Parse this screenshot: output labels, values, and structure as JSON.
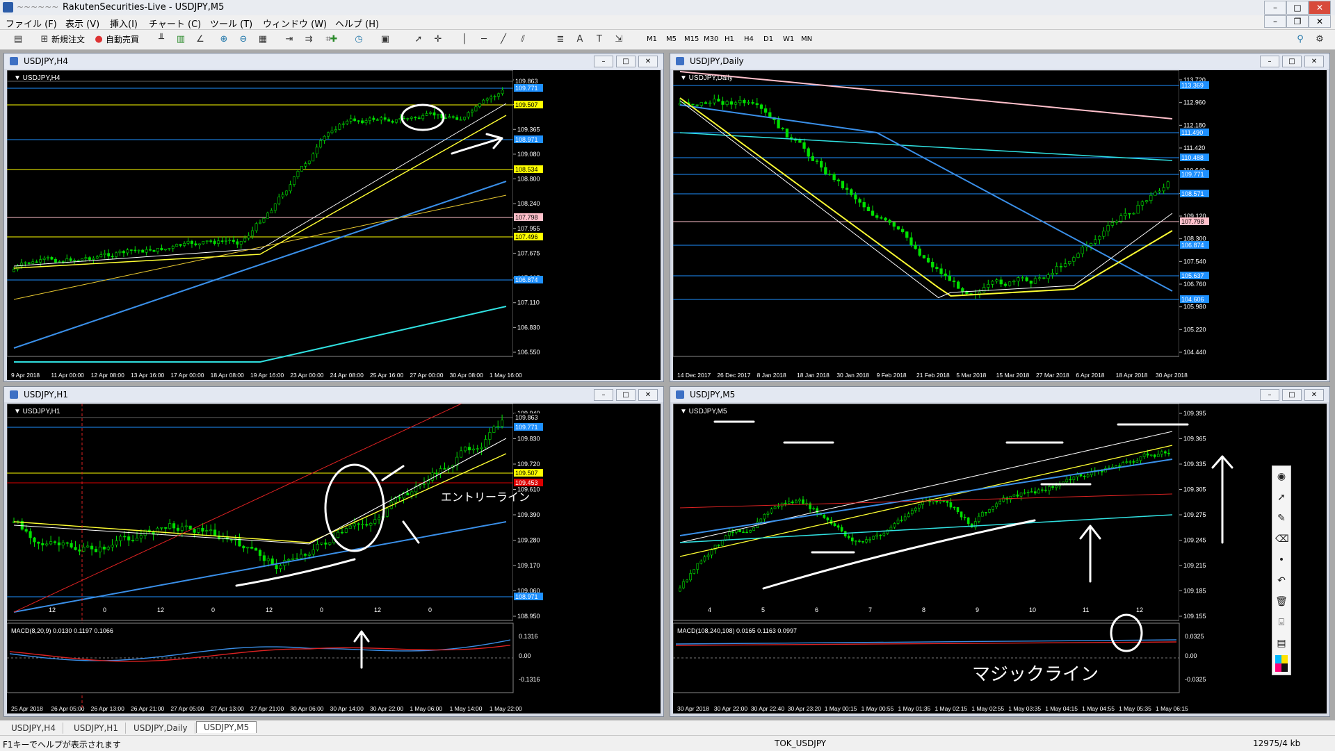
{
  "app": {
    "title": "RakutenSecurities-Live - USDJPY,M5",
    "redacted": "~~~~~~"
  },
  "menu": [
    "ファイル (F)",
    "表示 (V)",
    "挿入(I)",
    "チャート (C)",
    "ツール (T)",
    "ウィンドウ (W)",
    "ヘルプ (H)"
  ],
  "toolbar": {
    "new_order": "新規注文",
    "auto_trade": "自動売買",
    "timeframes": [
      "M1",
      "M5",
      "M15",
      "M30",
      "H1",
      "H4",
      "D1",
      "W1",
      "MN"
    ]
  },
  "windows": {
    "h4": {
      "title": "USDJPY,H4",
      "label": "USDJPY,H4",
      "yticks": [
        "109.925",
        "109.645",
        "109.365",
        "109.080",
        "108.800",
        "108.240",
        "107.955",
        "107.675",
        "107.395",
        "107.110",
        "106.830",
        "106.550"
      ],
      "price_tags": [
        {
          "text": "109.863",
          "color": "#ffffff",
          "bg": "#000000"
        },
        {
          "text": "109.771",
          "color": "#ffffff",
          "bg": "#1e90ff"
        },
        {
          "text": "109.507",
          "color": "#000000",
          "bg": "#ffff00"
        },
        {
          "text": "108.971",
          "color": "#ffffff",
          "bg": "#1e90ff"
        },
        {
          "text": "108.534",
          "color": "#000000",
          "bg": "#ffff00"
        },
        {
          "text": "107.798",
          "color": "#000000",
          "bg": "#ffc0cb"
        },
        {
          "text": "107.496",
          "color": "#000000",
          "bg": "#ffff00"
        },
        {
          "text": "106.874",
          "color": "#ffffff",
          "bg": "#1e90ff"
        }
      ],
      "xticks": [
        "9 Apr 2018",
        "11 Apr 00:00",
        "12 Apr 08:00",
        "13 Apr 16:00",
        "17 Apr 00:00",
        "18 Apr 08:00",
        "19 Apr 16:00",
        "23 Apr 00:00",
        "24 Apr 08:00",
        "25 Apr 16:00",
        "27 Apr 00:00",
        "30 Apr 08:00",
        "1 May 16:00"
      ]
    },
    "daily": {
      "title": "USDJPY,Daily",
      "label": "USDJPY,Daily",
      "yticks": [
        "113.720",
        "112.960",
        "112.180",
        "111.420",
        "110.640",
        "109.880",
        "109.120",
        "108.300",
        "107.540",
        "106.760",
        "105.980",
        "105.220",
        "104.440"
      ],
      "price_tags": [
        {
          "text": "113.369",
          "color": "#ffffff",
          "bg": "#1e90ff"
        },
        {
          "text": "111.490",
          "color": "#ffffff",
          "bg": "#1e90ff"
        },
        {
          "text": "110.488",
          "color": "#ffffff",
          "bg": "#1e90ff"
        },
        {
          "text": "109.771",
          "color": "#ffffff",
          "bg": "#1e90ff"
        },
        {
          "text": "108.571",
          "color": "#ffffff",
          "bg": "#1e90ff"
        },
        {
          "text": "107.798",
          "color": "#000000",
          "bg": "#ffc0cb"
        },
        {
          "text": "106.874",
          "color": "#ffffff",
          "bg": "#1e90ff"
        },
        {
          "text": "105.637",
          "color": "#ffffff",
          "bg": "#1e90ff"
        },
        {
          "text": "104.606",
          "color": "#ffffff",
          "bg": "#1e90ff"
        }
      ],
      "xticks": [
        "14 Dec 2017",
        "26 Dec 2017",
        "8 Jan 2018",
        "18 Jan 2018",
        "30 Jan 2018",
        "9 Feb 2018",
        "21 Feb 2018",
        "5 Mar 2018",
        "15 Mar 2018",
        "27 Mar 2018",
        "6 Apr 2018",
        "18 Apr 2018",
        "30 Apr 2018"
      ]
    },
    "h1": {
      "title": "USDJPY,H1",
      "label": "USDJPY,H1",
      "yticks": [
        "109.940",
        "109.830",
        "109.720",
        "109.610",
        "109.390",
        "109.280",
        "109.170",
        "109.060",
        "108.950"
      ],
      "price_tags": [
        {
          "text": "109.863",
          "color": "#ffffff",
          "bg": "#000000"
        },
        {
          "text": "109.771",
          "color": "#ffffff",
          "bg": "#1e90ff"
        },
        {
          "text": "109.507",
          "color": "#000000",
          "bg": "#ffff00"
        },
        {
          "text": "109.453",
          "color": "#ffffff",
          "bg": "#dd0000"
        },
        {
          "text": "108.971",
          "color": "#ffffff",
          "bg": "#1e90ff"
        }
      ],
      "period_labels": [
        "12",
        "0",
        "12",
        "0",
        "12",
        "0",
        "12",
        "0"
      ],
      "macd_label": "MACD(8,20,9) 0.0130 0.1197 0.1066",
      "macd_ticks": [
        "0.1316",
        "0.00",
        "-0.1316"
      ],
      "xticks": [
        "25 Apr 2018",
        "26 Apr 05:00",
        "26 Apr 13:00",
        "26 Apr 21:00",
        "27 Apr 05:00",
        "27 Apr 13:00",
        "27 Apr 21:00",
        "30 Apr 06:00",
        "30 Apr 14:00",
        "30 Apr 22:00",
        "1 May 06:00",
        "1 May 14:00",
        "1 May 22:00"
      ],
      "annotations": {
        "entry_line": "エントリーライン"
      }
    },
    "m5": {
      "title": "USDJPY,M5",
      "label": "USDJPY,M5",
      "yticks": [
        "109.395",
        "109.365",
        "109.335",
        "109.305",
        "109.275",
        "109.245",
        "109.215",
        "109.185",
        "109.155"
      ],
      "period_labels": [
        "4",
        "5",
        "6",
        "7",
        "8",
        "9",
        "10",
        "11",
        "12"
      ],
      "macd_label": "MACD(108,240,108) 0.0165 0.1163 0.0997",
      "macd_ticks": [
        "0.0325",
        "0.00",
        "-0.0325"
      ],
      "xticks": [
        "30 Apr 2018",
        "30 Apr 22:00",
        "30 Apr 22:40",
        "30 Apr 23:20",
        "1 May 00:15",
        "1 May 00:55",
        "1 May 01:35",
        "1 May 02:15",
        "1 May 02:55",
        "1 May 03:35",
        "1 May 04:15",
        "1 May 04:55",
        "1 May 05:35",
        "1 May 06:15"
      ],
      "annotations": {
        "magic_line": "マジックライン"
      }
    }
  },
  "tabs": [
    "USDJPY,H4",
    "USDJPY,H1",
    "USDJPY,Daily",
    "USDJPY,M5"
  ],
  "status": {
    "help": "F1キーでヘルプが表示されます",
    "profile": "TOK_USDJPY",
    "traffic": "12975/4 kb"
  }
}
